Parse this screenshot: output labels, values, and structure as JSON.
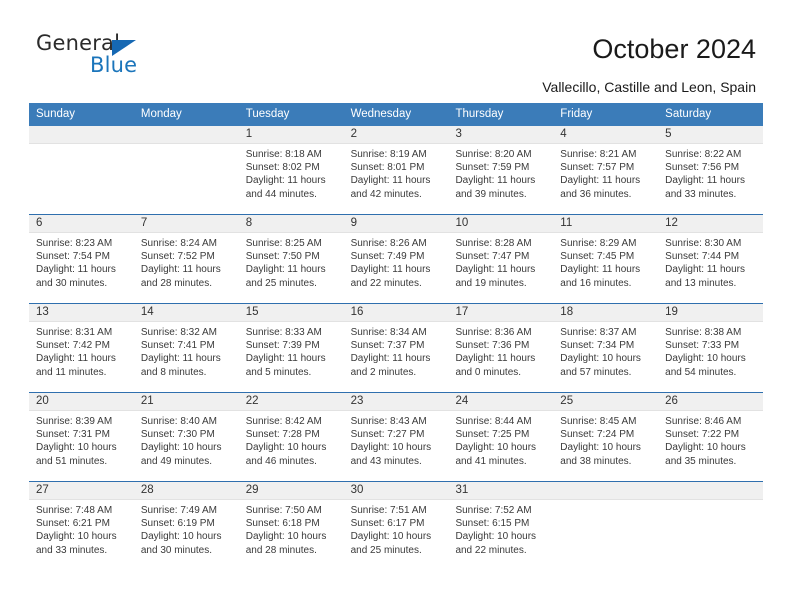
{
  "brand": {
    "name_top": "General",
    "name_bottom": "Blue",
    "accent_color": "#1b75bb",
    "triangle_color": "#1668b3"
  },
  "header": {
    "title": "October 2024",
    "subtitle": "Vallecillo, Castille and Leon, Spain"
  },
  "calendar": {
    "header_color": "#3b7cb9",
    "weekdays": [
      "Sunday",
      "Monday",
      "Tuesday",
      "Wednesday",
      "Thursday",
      "Friday",
      "Saturday"
    ],
    "labels": {
      "sunrise": "Sunrise:",
      "sunset": "Sunset:",
      "daylight": "Daylight:"
    },
    "weeks": [
      [
        {
          "day": "",
          "empty": true
        },
        {
          "day": "",
          "empty": true
        },
        {
          "day": "1",
          "sunrise": "Sunrise: 8:18 AM",
          "sunset": "Sunset: 8:02 PM",
          "daylight": "Daylight: 11 hours and 44 minutes."
        },
        {
          "day": "2",
          "sunrise": "Sunrise: 8:19 AM",
          "sunset": "Sunset: 8:01 PM",
          "daylight": "Daylight: 11 hours and 42 minutes."
        },
        {
          "day": "3",
          "sunrise": "Sunrise: 8:20 AM",
          "sunset": "Sunset: 7:59 PM",
          "daylight": "Daylight: 11 hours and 39 minutes."
        },
        {
          "day": "4",
          "sunrise": "Sunrise: 8:21 AM",
          "sunset": "Sunset: 7:57 PM",
          "daylight": "Daylight: 11 hours and 36 minutes."
        },
        {
          "day": "5",
          "sunrise": "Sunrise: 8:22 AM",
          "sunset": "Sunset: 7:56 PM",
          "daylight": "Daylight: 11 hours and 33 minutes."
        }
      ],
      [
        {
          "day": "6",
          "sunrise": "Sunrise: 8:23 AM",
          "sunset": "Sunset: 7:54 PM",
          "daylight": "Daylight: 11 hours and 30 minutes."
        },
        {
          "day": "7",
          "sunrise": "Sunrise: 8:24 AM",
          "sunset": "Sunset: 7:52 PM",
          "daylight": "Daylight: 11 hours and 28 minutes."
        },
        {
          "day": "8",
          "sunrise": "Sunrise: 8:25 AM",
          "sunset": "Sunset: 7:50 PM",
          "daylight": "Daylight: 11 hours and 25 minutes."
        },
        {
          "day": "9",
          "sunrise": "Sunrise: 8:26 AM",
          "sunset": "Sunset: 7:49 PM",
          "daylight": "Daylight: 11 hours and 22 minutes."
        },
        {
          "day": "10",
          "sunrise": "Sunrise: 8:28 AM",
          "sunset": "Sunset: 7:47 PM",
          "daylight": "Daylight: 11 hours and 19 minutes."
        },
        {
          "day": "11",
          "sunrise": "Sunrise: 8:29 AM",
          "sunset": "Sunset: 7:45 PM",
          "daylight": "Daylight: 11 hours and 16 minutes."
        },
        {
          "day": "12",
          "sunrise": "Sunrise: 8:30 AM",
          "sunset": "Sunset: 7:44 PM",
          "daylight": "Daylight: 11 hours and 13 minutes."
        }
      ],
      [
        {
          "day": "13",
          "sunrise": "Sunrise: 8:31 AM",
          "sunset": "Sunset: 7:42 PM",
          "daylight": "Daylight: 11 hours and 11 minutes."
        },
        {
          "day": "14",
          "sunrise": "Sunrise: 8:32 AM",
          "sunset": "Sunset: 7:41 PM",
          "daylight": "Daylight: 11 hours and 8 minutes."
        },
        {
          "day": "15",
          "sunrise": "Sunrise: 8:33 AM",
          "sunset": "Sunset: 7:39 PM",
          "daylight": "Daylight: 11 hours and 5 minutes."
        },
        {
          "day": "16",
          "sunrise": "Sunrise: 8:34 AM",
          "sunset": "Sunset: 7:37 PM",
          "daylight": "Daylight: 11 hours and 2 minutes."
        },
        {
          "day": "17",
          "sunrise": "Sunrise: 8:36 AM",
          "sunset": "Sunset: 7:36 PM",
          "daylight": "Daylight: 11 hours and 0 minutes."
        },
        {
          "day": "18",
          "sunrise": "Sunrise: 8:37 AM",
          "sunset": "Sunset: 7:34 PM",
          "daylight": "Daylight: 10 hours and 57 minutes."
        },
        {
          "day": "19",
          "sunrise": "Sunrise: 8:38 AM",
          "sunset": "Sunset: 7:33 PM",
          "daylight": "Daylight: 10 hours and 54 minutes."
        }
      ],
      [
        {
          "day": "20",
          "sunrise": "Sunrise: 8:39 AM",
          "sunset": "Sunset: 7:31 PM",
          "daylight": "Daylight: 10 hours and 51 minutes."
        },
        {
          "day": "21",
          "sunrise": "Sunrise: 8:40 AM",
          "sunset": "Sunset: 7:30 PM",
          "daylight": "Daylight: 10 hours and 49 minutes."
        },
        {
          "day": "22",
          "sunrise": "Sunrise: 8:42 AM",
          "sunset": "Sunset: 7:28 PM",
          "daylight": "Daylight: 10 hours and 46 minutes."
        },
        {
          "day": "23",
          "sunrise": "Sunrise: 8:43 AM",
          "sunset": "Sunset: 7:27 PM",
          "daylight": "Daylight: 10 hours and 43 minutes."
        },
        {
          "day": "24",
          "sunrise": "Sunrise: 8:44 AM",
          "sunset": "Sunset: 7:25 PM",
          "daylight": "Daylight: 10 hours and 41 minutes."
        },
        {
          "day": "25",
          "sunrise": "Sunrise: 8:45 AM",
          "sunset": "Sunset: 7:24 PM",
          "daylight": "Daylight: 10 hours and 38 minutes."
        },
        {
          "day": "26",
          "sunrise": "Sunrise: 8:46 AM",
          "sunset": "Sunset: 7:22 PM",
          "daylight": "Daylight: 10 hours and 35 minutes."
        }
      ],
      [
        {
          "day": "27",
          "sunrise": "Sunrise: 7:48 AM",
          "sunset": "Sunset: 6:21 PM",
          "daylight": "Daylight: 10 hours and 33 minutes."
        },
        {
          "day": "28",
          "sunrise": "Sunrise: 7:49 AM",
          "sunset": "Sunset: 6:19 PM",
          "daylight": "Daylight: 10 hours and 30 minutes."
        },
        {
          "day": "29",
          "sunrise": "Sunrise: 7:50 AM",
          "sunset": "Sunset: 6:18 PM",
          "daylight": "Daylight: 10 hours and 28 minutes."
        },
        {
          "day": "30",
          "sunrise": "Sunrise: 7:51 AM",
          "sunset": "Sunset: 6:17 PM",
          "daylight": "Daylight: 10 hours and 25 minutes."
        },
        {
          "day": "31",
          "sunrise": "Sunrise: 7:52 AM",
          "sunset": "Sunset: 6:15 PM",
          "daylight": "Daylight: 10 hours and 22 minutes."
        },
        {
          "day": "",
          "empty": true
        },
        {
          "day": "",
          "empty": true
        }
      ]
    ]
  }
}
